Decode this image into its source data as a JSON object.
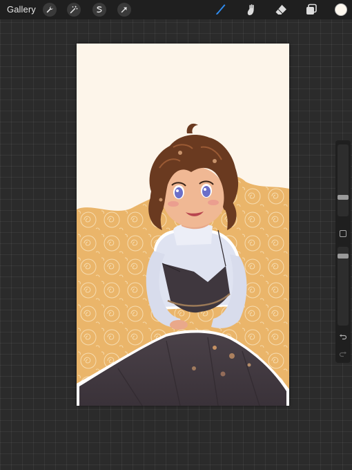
{
  "toolbar": {
    "gallery_label": "Gallery",
    "left_tools": [
      {
        "icon": "wrench-icon"
      },
      {
        "icon": "magic-wand-icon"
      },
      {
        "icon": "selection-icon"
      },
      {
        "icon": "transform-arrow-icon"
      }
    ],
    "right_tools": [
      {
        "icon": "brush-icon",
        "active": true,
        "color": "#2f8cf0"
      },
      {
        "icon": "smudge-icon",
        "active": false
      },
      {
        "icon": "eraser-icon",
        "active": false
      },
      {
        "icon": "layers-icon",
        "active": false
      }
    ],
    "current_color": "#fdf8ee"
  },
  "sidebar": {
    "brush_size_level": 0.24,
    "opacity_level": 0.8,
    "undo_icon": "undo-arrow-icon",
    "redo_icon": "redo-arrow-icon"
  },
  "canvas": {
    "artwork": "illustration-portrait",
    "background_color": "#fdf5ea",
    "accent_color": "#eab56a"
  }
}
